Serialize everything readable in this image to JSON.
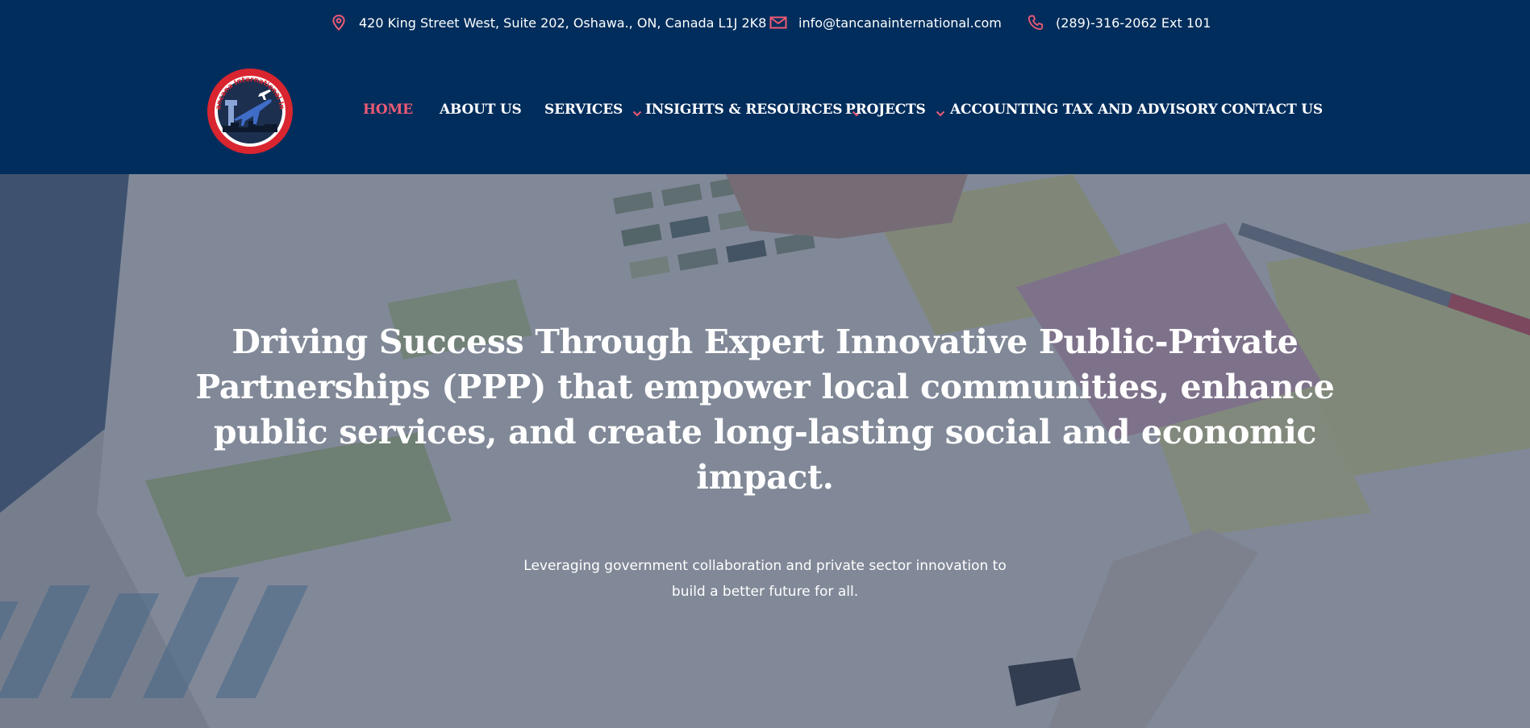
{
  "topbar": {
    "address": "420 King Street West, Suite 202, Oshawa., ON, Canada L1J 2K8",
    "email": "info@tancanainternational.com",
    "phone": "(289)-316-2062 Ext 101",
    "icons": {
      "address": "location-pin-icon",
      "email": "envelope-icon",
      "phone": "phone-icon"
    }
  },
  "logo": {
    "text": "Tancana International Inc"
  },
  "nav": {
    "items": [
      {
        "label": "HOME",
        "active": true,
        "has_dropdown": false
      },
      {
        "label": "ABOUT US",
        "active": false,
        "has_dropdown": false
      },
      {
        "label": "SERVICES",
        "active": false,
        "has_dropdown": true
      },
      {
        "label": "INSIGHTS & RESOURCES",
        "active": false,
        "has_dropdown": true
      },
      {
        "label": "PROJECTS",
        "active": false,
        "has_dropdown": true
      },
      {
        "label": "ACCOUNTING TAX AND ADVISORY",
        "active": false,
        "has_dropdown": false
      },
      {
        "label": "CONTACT US",
        "active": false,
        "has_dropdown": false
      }
    ]
  },
  "hero": {
    "title": "Driving Success Through Expert Innovative Public-Private Partnerships (PPP) that empower local communities, enhance public services, and create long-lasting social and economic impact.",
    "subtitle_line1": "Leveraging government collaboration and private sector innovation to",
    "subtitle_line2": "build a better future for all."
  },
  "colors": {
    "navy": "#002d5c",
    "accent": "#ee5a74",
    "white": "#ffffff",
    "logo_red": "#d9252f"
  }
}
